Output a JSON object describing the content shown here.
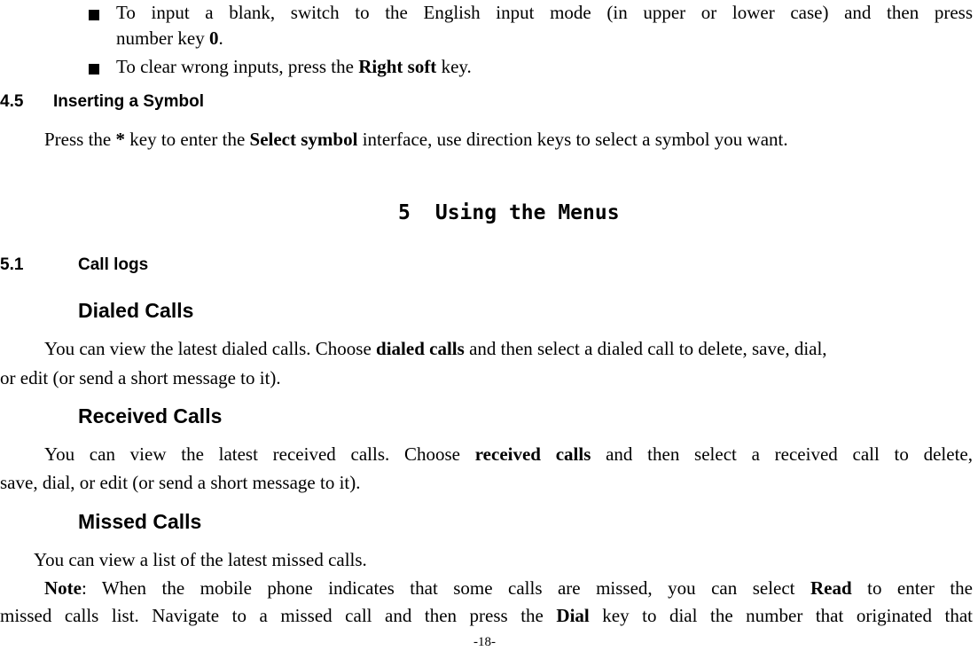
{
  "bullets": [
    {
      "line1": [
        "To input a blank, switch to the English input mode (in upper or lower case) and then press"
      ],
      "line2_pre": "number key ",
      "line2_bold": "0",
      "line2_post": "."
    },
    {
      "pre": "To clear wrong inputs, press the ",
      "bold": "Right soft",
      "post": " key."
    }
  ],
  "section_4_5": {
    "number": "4.5",
    "title": "Inserting a Symbol",
    "para_pre": "Press the ",
    "para_bold1": "*",
    "para_mid": " key to enter the ",
    "para_bold2": "Select symbol",
    "para_post": " interface, use direction keys to select a symbol you want."
  },
  "chapter_5": {
    "number": "5",
    "title": "Using the Menus"
  },
  "section_5_1": {
    "number": "5.1",
    "title": "Call logs"
  },
  "dialed": {
    "heading": "Dialed Calls",
    "l1_pre": "You can view the latest dialed calls. Choose ",
    "l1_bold": "dialed calls",
    "l1_post": " and then select a dialed call to delete, save, dial,",
    "l2": "or edit (or send a short message to it)."
  },
  "received": {
    "heading": "Received Calls",
    "l1_pre": "You can view the latest received calls. Choose ",
    "l1_bold": "received calls",
    "l1_post": " and then select a received call to delete,",
    "l2": "save, dial, or edit (or send a short message to it)."
  },
  "missed": {
    "heading": "Missed Calls",
    "l1": "You can view a list of the latest missed calls.",
    "note_bold": "Note",
    "note_l1_a": ": When the mobile phone indicates that some calls are missed, you can select ",
    "note_l1_bold": "Read",
    "note_l1_b": " to enter the",
    "note_l2_a": "missed calls list. Navigate to a missed call and then press the ",
    "note_l2_bold": "Dial",
    "note_l2_b": " key to dial the number that originated that"
  },
  "page_number": "-18-"
}
